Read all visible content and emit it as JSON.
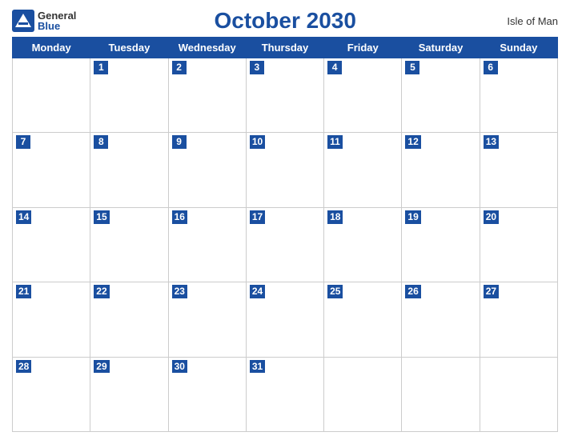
{
  "header": {
    "logo_general": "General",
    "logo_blue": "Blue",
    "title": "October 2030",
    "region": "Isle of Man"
  },
  "weekdays": [
    "Monday",
    "Tuesday",
    "Wednesday",
    "Thursday",
    "Friday",
    "Saturday",
    "Sunday"
  ],
  "weeks": [
    [
      null,
      1,
      2,
      3,
      4,
      5,
      6
    ],
    [
      7,
      8,
      9,
      10,
      11,
      12,
      13
    ],
    [
      14,
      15,
      16,
      17,
      18,
      19,
      20
    ],
    [
      21,
      22,
      23,
      24,
      25,
      26,
      27
    ],
    [
      28,
      29,
      30,
      31,
      null,
      null,
      null
    ]
  ]
}
